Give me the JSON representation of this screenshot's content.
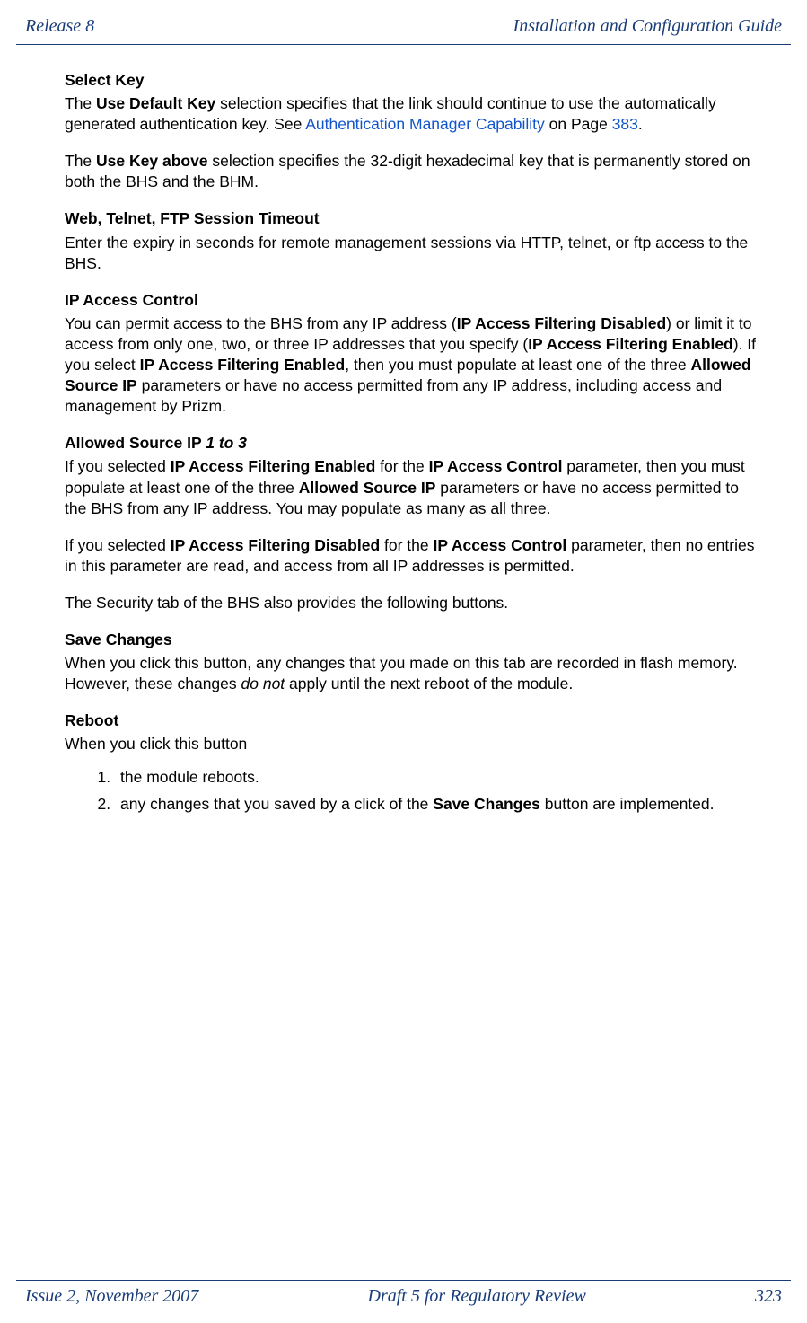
{
  "header": {
    "left": "Release 8",
    "right": "Installation and Configuration Guide"
  },
  "footer": {
    "left": "Issue 2, November 2007",
    "center": "Draft 5 for Regulatory Review",
    "right": "323"
  },
  "sections": {
    "selectKey": {
      "heading": "Select Key",
      "p1_a": "The ",
      "p1_b_bold": "Use Default Key",
      "p1_c": " selection specifies that the link should continue to use the automatically generated authentication key. See ",
      "p1_link": "Authentication Manager Capability",
      "p1_d": " on Page ",
      "p1_pagelink": "383",
      "p1_e": ".",
      "p2_a": "The ",
      "p2_b_bold": "Use Key above",
      "p2_c": " selection specifies the 32-digit hexadecimal key that is permanently stored on both the BHS and the BHM."
    },
    "webTimeout": {
      "heading": "Web, Telnet, FTP Session Timeout",
      "p1": "Enter the expiry in seconds for remote management sessions via HTTP, telnet, or ftp access to the BHS."
    },
    "ipAccess": {
      "heading": "IP Access Control",
      "p1_a": "You can permit access to the BHS from any IP address (",
      "p1_b_bold": "IP Access Filtering Disabled",
      "p1_c": ") or limit it to access from only one, two, or three IP addresses that you specify (",
      "p1_d_bold": "IP Access Filtering Enabled",
      "p1_e": "). If you select ",
      "p1_f_bold": "IP Access Filtering Enabled",
      "p1_g": ", then you must populate at least one of the three ",
      "p1_h_bold": "Allowed Source IP",
      "p1_i": " parameters or have no access permitted from any IP address, including access and management by Prizm."
    },
    "allowedSource": {
      "heading_a": "Allowed Source IP ",
      "heading_b_italic": "1 to 3",
      "p1_a": "If you selected ",
      "p1_b_bold": "IP Access Filtering Enabled",
      "p1_c": " for the ",
      "p1_d_bold": "IP Access Control",
      "p1_e": " parameter, then you must populate at least one of the three ",
      "p1_f_bold": "Allowed Source IP",
      "p1_g": " parameters or have no access permitted to the BHS from any IP address. You may populate as many as all three.",
      "p2_a": "If you selected ",
      "p2_b_bold": "IP Access Filtering Disabled",
      "p2_c": " for the ",
      "p2_d_bold": "IP Access Control",
      "p2_e": " parameter, then no entries in this parameter are read, and access from all IP addresses is permitted.",
      "p3": "The Security tab of the BHS also provides the following buttons."
    },
    "saveChanges": {
      "heading": "Save Changes",
      "p1_a": "When you click this button, any changes that you made on this tab are recorded in flash memory. However, these changes ",
      "p1_b_italic": "do not",
      "p1_c": " apply until the next reboot of the module."
    },
    "reboot": {
      "heading": "Reboot",
      "p1": "When you click this button",
      "li1": "the module reboots.",
      "li2_a": "any changes that you saved by a click of the ",
      "li2_b_bold": "Save Changes",
      "li2_c": " button are implemented."
    }
  }
}
